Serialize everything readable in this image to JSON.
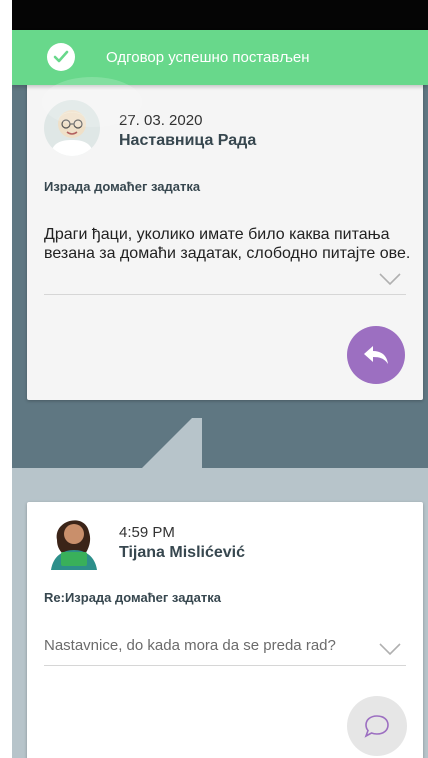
{
  "toast": {
    "message": "Одговор успешно постављен",
    "color": "#68d88b"
  },
  "original_post": {
    "date": "27. 03. 2020",
    "author": "Наставница Рада",
    "subject": "Израда домаћег задатка",
    "body": "Драги ђаци, уколико имате било каква питања везана за домаћи задатак, слободно питајте ове.",
    "avatar_icon": "teacher-avatar",
    "reply_button_icon": "reply-icon",
    "reply_button_color": "#9c6fc1",
    "expand_icon": "chevron-down-icon"
  },
  "reply_post": {
    "time": "4:59 PM",
    "author": "Tijana Mislićević",
    "subject": "Re:Израда домаћег задатка",
    "body": "Nastavnice, do kada mora da se preda rad?",
    "avatar_icon": "student-avatar",
    "comment_button_icon": "comment-icon",
    "expand_icon": "chevron-down-icon"
  }
}
